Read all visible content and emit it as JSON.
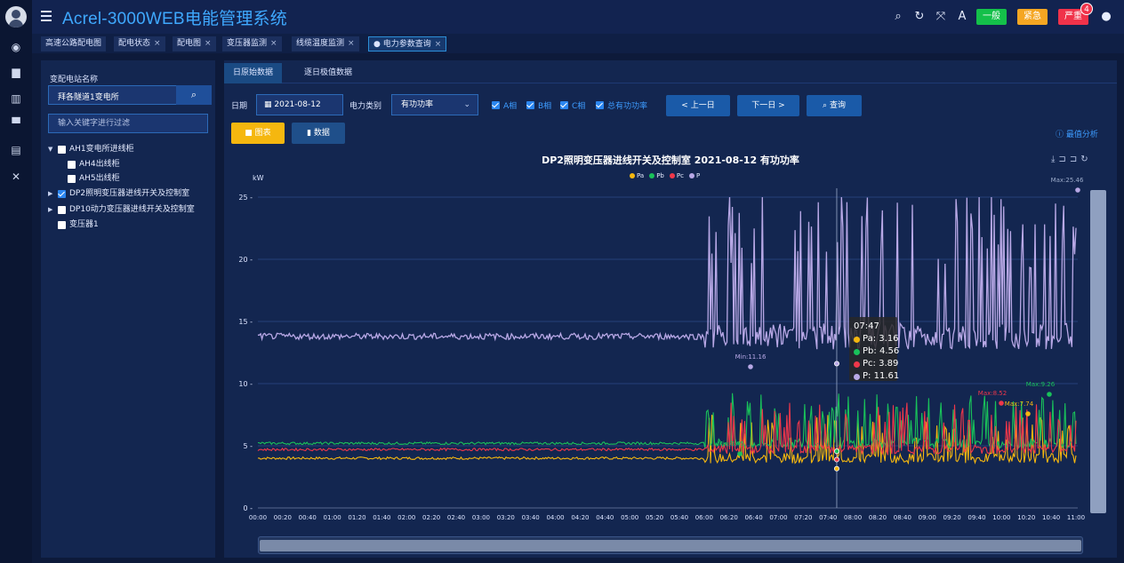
{
  "app": {
    "title": "Acrel-3000WEB电能管理系统"
  },
  "header": {
    "alerts": [
      {
        "label": "一般",
        "color": "#14c04a"
      },
      {
        "label": "紧急",
        "color": "#f5a622"
      },
      {
        "label": "严重",
        "color": "#f0324a"
      }
    ],
    "alert_count": "4"
  },
  "tabs": [
    {
      "label": "高速公路配电图",
      "closable": false
    },
    {
      "label": "配电状态",
      "closable": true
    },
    {
      "label": "配电图",
      "closable": true
    },
    {
      "label": "变压器监测",
      "closable": true
    },
    {
      "label": "线缆温度监测",
      "closable": true
    },
    {
      "label": "● 电力参数查询",
      "closable": true,
      "active": true
    }
  ],
  "sidebar": {
    "station_label": "变配电站名称",
    "station_value": "拜各隧道1变电所",
    "filter_placeholder": "输入关键字进行过滤",
    "tree": [
      {
        "label": "AH1变电所进线柜",
        "level": 0,
        "expanded": true,
        "checked": false
      },
      {
        "label": "AH4出线柜",
        "level": 1,
        "checked": false
      },
      {
        "label": "AH5出线柜",
        "level": 1,
        "checked": false
      },
      {
        "label": "DP2照明变压器进线开关及控制室",
        "level": 0,
        "expanded": false,
        "checked": true
      },
      {
        "label": "DP10动力变压器进线开关及控制室",
        "level": 0,
        "expanded": false,
        "checked": false
      },
      {
        "label": "变压器1",
        "level": 0,
        "checked": false
      }
    ]
  },
  "main": {
    "subtabs": [
      "日原始数据",
      "逐日极值数据"
    ],
    "date_label": "日期",
    "date_value": "2021-08-12",
    "category_label": "电力类别",
    "category_value": "有功功率",
    "phase_checks": [
      "A相",
      "B相",
      "C相",
      "总有功功率"
    ],
    "prev_day": "< 上一日",
    "next_day": "下一日 >",
    "query": "查询",
    "view_chart": "图表",
    "view_data": "数据",
    "max_analysis": "最值分析"
  },
  "colors": {
    "Pa": "#f5b70f",
    "Pb": "#19c15a",
    "Pc": "#f0374a",
    "P": "#b8a8e6",
    "accent": "#2c8fd8"
  },
  "chart_data": {
    "type": "line",
    "title": "DP2照明变压器进线开关及控制室  2021-08-12  有功功率",
    "ylabel": "kW",
    "ylim": [
      0,
      25
    ],
    "yticks": [
      0,
      5,
      10,
      15,
      20,
      25
    ],
    "xticks": [
      "00:00",
      "00:20",
      "00:40",
      "01:00",
      "01:20",
      "01:40",
      "02:00",
      "02:20",
      "02:40",
      "03:00",
      "03:20",
      "03:40",
      "04:00",
      "04:20",
      "04:40",
      "05:00",
      "05:20",
      "05:40",
      "06:00",
      "06:20",
      "06:40",
      "07:00",
      "07:20",
      "07:40",
      "08:00",
      "08:20",
      "08:40",
      "09:00",
      "09:20",
      "09:40",
      "10:00",
      "10:20",
      "10:40",
      "11:00"
    ],
    "series": [
      {
        "name": "Pa",
        "baseline": 4.0,
        "active_min": 3.0,
        "active_max": 7.5
      },
      {
        "name": "Pb",
        "baseline": 5.2,
        "active_min": 4.2,
        "active_max": 9.26
      },
      {
        "name": "Pc",
        "baseline": 4.7,
        "active_min": 3.8,
        "active_max": 8.52
      },
      {
        "name": "P",
        "baseline": 13.8,
        "active_min": 11.2,
        "active_max": 25.46
      }
    ],
    "annotations": [
      {
        "text": "Max:25.46"
      },
      {
        "text": "Max:9.26"
      },
      {
        "text": "Max:8.52"
      },
      {
        "text": "Max:7.74"
      },
      {
        "text": "Min:11.16"
      },
      {
        "text": "Min:3.45"
      }
    ],
    "tooltip": {
      "time": "07:47",
      "rows": [
        {
          "name": "Pa",
          "value": "3.16"
        },
        {
          "name": "Pb",
          "value": "4.56"
        },
        {
          "name": "Pc",
          "value": "3.89"
        },
        {
          "name": "P",
          "value": "11.61"
        }
      ]
    }
  }
}
